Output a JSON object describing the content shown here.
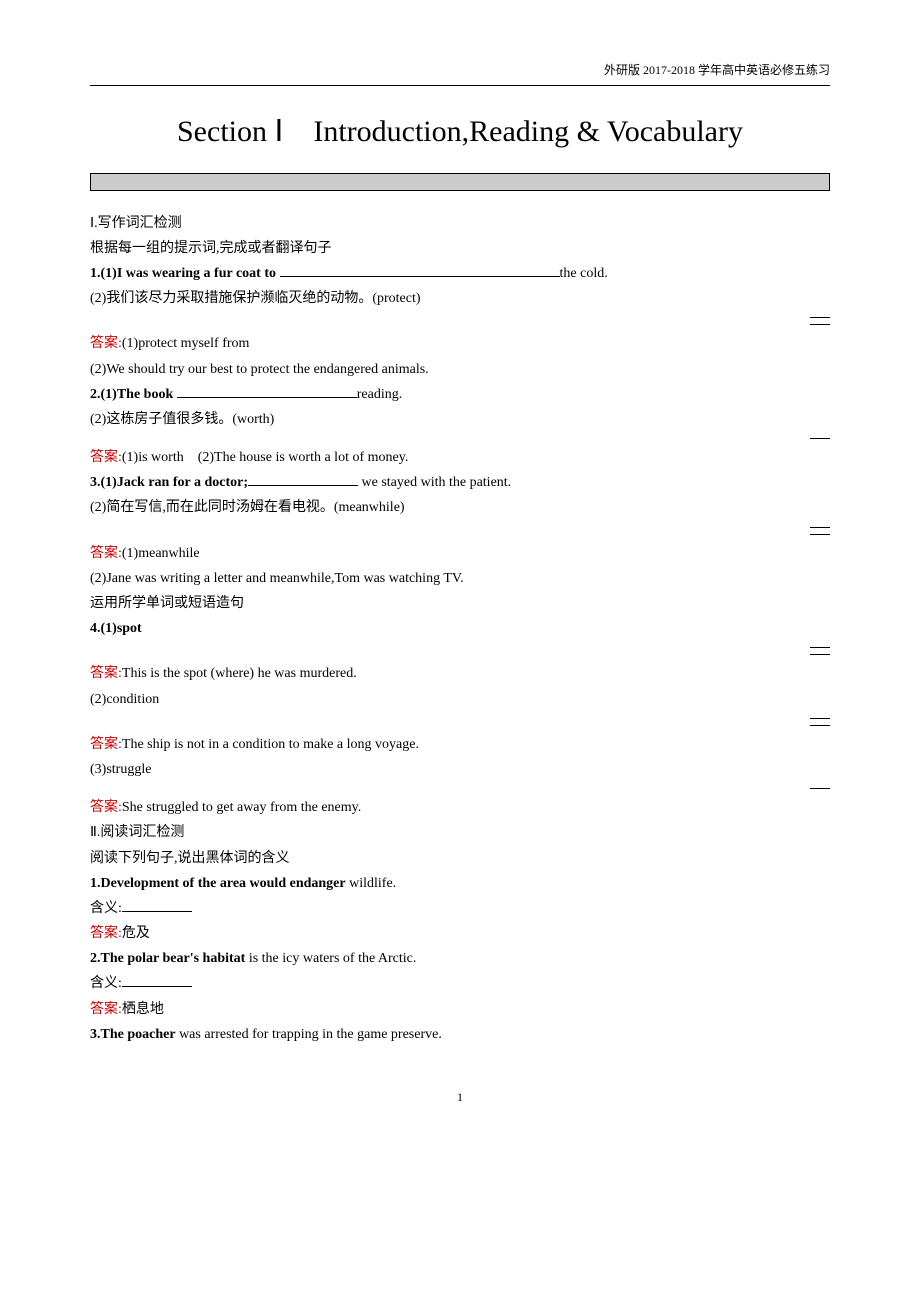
{
  "header": "外研版 2017-2018 学年高中英语必修五练习",
  "title": "Section Ⅰ　Introduction,Reading & Vocabulary",
  "s1": {
    "heading": "Ⅰ.写作词汇检测",
    "instruction": "根据每一组的提示词,完成或者翻译句子",
    "q1_1a": "1.(1)I was wearing a fur coat to ",
    "q1_1b": "the cold.",
    "q1_2": "(2)我们该尽力采取措施保护濒临灭绝的动物。(protect)",
    "ans_label": "答案:",
    "a1_1": "(1)protect myself from",
    "a1_2": "(2)We should try our best to protect the endangered animals.",
    "q2_1a": "2.(1)The book ",
    "q2_1b": "reading.",
    "q2_2": "(2)这栋房子值很多钱。(worth)",
    "a2": "(1)is worth　(2)The house is worth a lot of money.",
    "q3_1a": "3.(1)Jack ran for a doctor;",
    "q3_1b": " we stayed with the patient.",
    "q3_2": "(2)简在写信,而在此同时汤姆在看电视。(meanwhile)",
    "a3_1": "(1)meanwhile",
    "a3_2": "(2)Jane was writing a letter and meanwhile,Tom was watching TV.",
    "instruction2": "运用所学单词或短语造句",
    "q4_1": "4.(1)spot",
    "a4_1": "This is the spot (where) he was murdered.",
    "q4_2": "(2)condition",
    "a4_2": "The ship is not in a condition to make a long voyage.",
    "q4_3": "(3)struggle",
    "a4_3": "She struggled to get away from the enemy."
  },
  "s2": {
    "heading": "Ⅱ.阅读词汇检测",
    "instruction": "阅读下列句子,说出黑体词的含义",
    "q1a": "1.Development of the area would ",
    "q1bold": "endanger",
    "q1b": " wildlife.",
    "meaning_label": "含义:",
    "a1": "危及",
    "q2a": "2.The polar bear's ",
    "q2bold": "habitat",
    "q2b": " is the icy waters of the Arctic.",
    "a2": "栖息地",
    "q3a": "3.The ",
    "q3bold": "poacher",
    "q3b": " was arrested for trapping in the game preserve."
  },
  "page_num": "1"
}
